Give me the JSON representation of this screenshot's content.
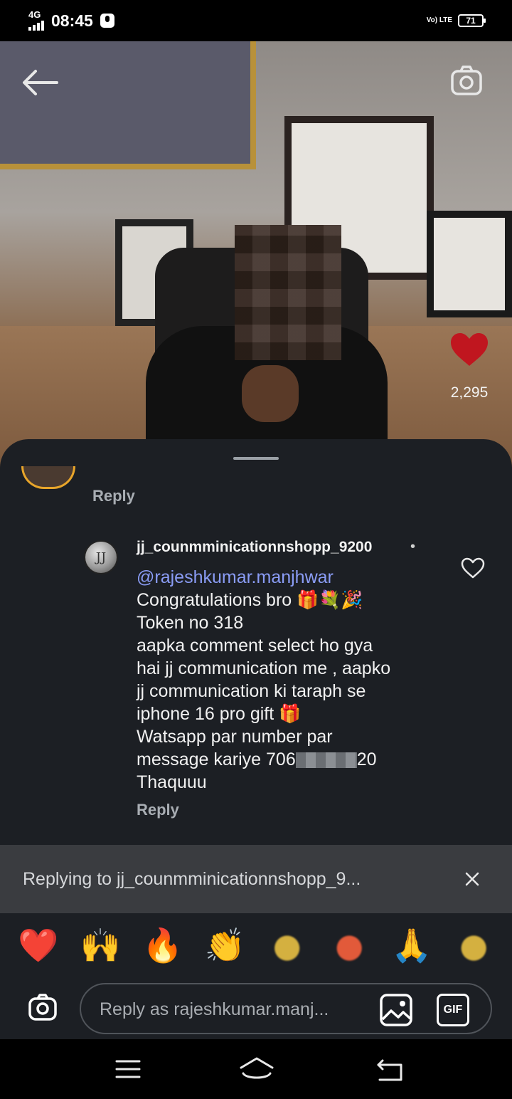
{
  "status_bar": {
    "network": "4G",
    "time": "08:45",
    "volte": "Vo) LTE",
    "battery": "71"
  },
  "video": {
    "like_count": "2,295"
  },
  "comments": {
    "reply_label_top": "Reply",
    "comment": {
      "avatar_initials": "JJ",
      "username": "jj_counmminicationnshopp_9200",
      "dot": "•",
      "mention": "@rajeshkumar.manjhwar",
      "lines": [
        "Congratulations bro 🎁💐🎉",
        "Token no 318",
        "aapka comment select ho gya",
        "hai jj communication me , aapko",
        "jj communication ki taraph se",
        "iphone 16 pro gift 🎁",
        "Watsapp par number par"
      ],
      "phone_prefix": "message kariye 706",
      "phone_suffix": "20",
      "last_line": "Thaquuu",
      "reply_label": "Reply"
    }
  },
  "replying": {
    "text": "Replying to jj_counmminicationnshopp_9..."
  },
  "emoji_bar": [
    "❤️",
    "🙌",
    "🔥",
    "👏",
    "●",
    "●",
    "🙏",
    "●"
  ],
  "composer": {
    "placeholder": "Reply as rajeshkumar.manj...",
    "gif_label": "GIF"
  },
  "colors": {
    "sheet_bg": "#1c1f24",
    "mention": "#8a9cf5",
    "heart": "#c0161f"
  }
}
